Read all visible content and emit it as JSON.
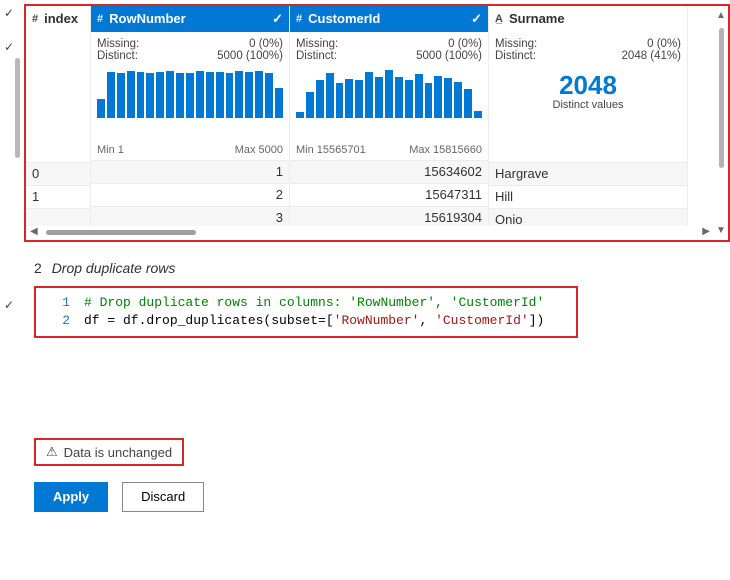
{
  "columns": {
    "index": {
      "type_icon": "#",
      "label": "index",
      "selected": false,
      "rows": [
        "0",
        "1",
        ""
      ]
    },
    "rownumber": {
      "type_icon": "#",
      "label": "RowNumber",
      "selected": true,
      "missing_label": "Missing:",
      "missing_value": "0 (0%)",
      "distinct_label": "Distinct:",
      "distinct_value": "5000 (100%)",
      "min_label": "Min 1",
      "max_label": "Max 5000",
      "rows": [
        "1",
        "2",
        "3"
      ]
    },
    "customerid": {
      "type_icon": "#",
      "label": "CustomerId",
      "selected": true,
      "missing_label": "Missing:",
      "missing_value": "0 (0%)",
      "distinct_label": "Distinct:",
      "distinct_value": "5000 (100%)",
      "min_label": "Min 15565701",
      "max_label": "Max 15815660",
      "rows": [
        "15634602",
        "15647311",
        "15619304"
      ]
    },
    "surname": {
      "type_icon": "A̲",
      "label": "Surname",
      "selected": false,
      "missing_label": "Missing:",
      "missing_value": "0 (0%)",
      "distinct_label": "Distinct:",
      "distinct_value": "2048 (41%)",
      "big_number": "2048",
      "big_number_sub": "Distinct values",
      "rows": [
        "Hargrave",
        "Hill",
        "Onio"
      ]
    }
  },
  "step": {
    "number": "2",
    "title": "Drop duplicate rows"
  },
  "code": {
    "ln1": "1",
    "ln2": "2",
    "c1": "# Drop duplicate rows in columns: 'RowNumber', 'CustomerId'",
    "c2a": "df = df.drop_duplicates(subset=[",
    "c2s1": "'RowNumber'",
    "c2sep": ", ",
    "c2s2": "'CustomerId'",
    "c2b": "])"
  },
  "status": {
    "text": "Data is unchanged"
  },
  "buttons": {
    "apply": "Apply",
    "discard": "Discard"
  }
}
